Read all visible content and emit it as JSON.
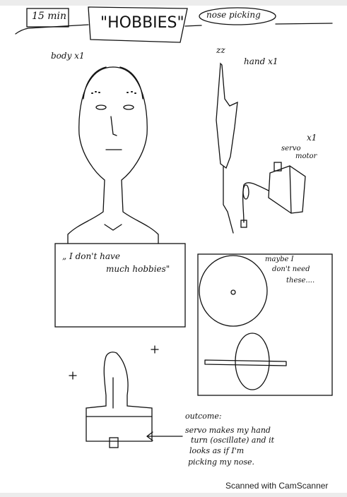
{
  "header": {
    "duration": "15 min",
    "title": "\"HOBBIES\"",
    "topic": "nose picking"
  },
  "parts": {
    "body_label": "body x1",
    "hand_label": "hand x1",
    "hand_mark": "zz",
    "servo_qty": "x1",
    "servo_label_1": "servo",
    "servo_label_2": "motor"
  },
  "speech": {
    "line1": "„ I don't have",
    "line2": "much hobbies\""
  },
  "discs_note": {
    "line1": "maybe I",
    "line2": "don't need",
    "line3": "these...."
  },
  "outcome": {
    "heading": "outcome:",
    "lines": [
      "servo makes my hand",
      "turn (oscillate) and it",
      "looks as if  I'm",
      "picking  my nose."
    ]
  },
  "watermark": "Scanned with CamScanner"
}
